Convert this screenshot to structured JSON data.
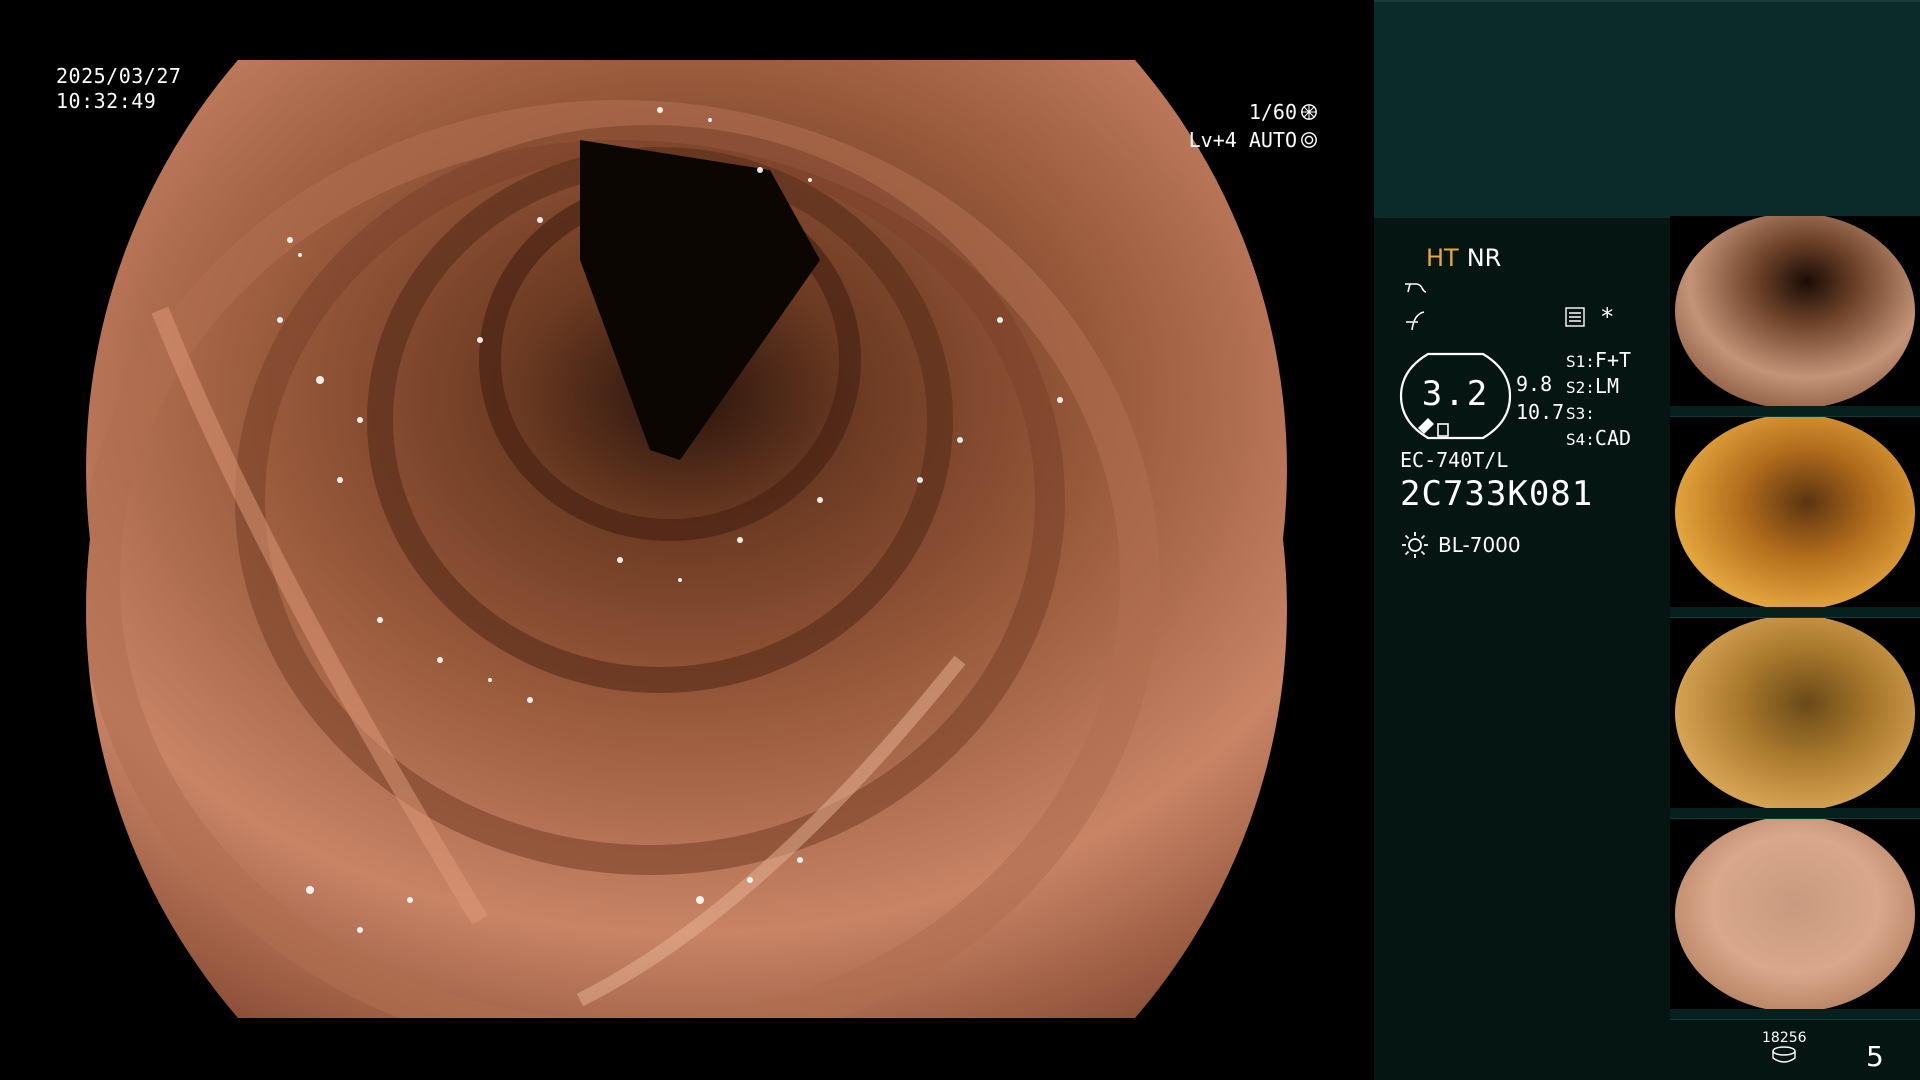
{
  "overlay": {
    "date": "2025/03/27",
    "time": "10:32:49",
    "shutter": "1/60",
    "iris": "Lv+4 AUTO"
  },
  "panel": {
    "mode_ht": "HT",
    "mode_nr": "NR",
    "gauge_value": "3.2",
    "gauge_upper": "9.8",
    "gauge_lower": "10.7",
    "presets": [
      {
        "key": "S1:",
        "value": "F+T"
      },
      {
        "key": "S2:",
        "value": "LM"
      },
      {
        "key": "S3:",
        "value": ""
      },
      {
        "key": "S4:",
        "value": "CAD"
      }
    ],
    "scope_model": "EC-740T/L",
    "scope_serial": "2C733K081",
    "light_source": "BL-7000",
    "storage_count": "18256",
    "capture_count": "5"
  },
  "icons": {
    "shutter": "shutter-icon",
    "iris": "iris-icon",
    "enhance": "enhance-icon",
    "flex": "flex-icon",
    "settings": "settings-icon",
    "light": "light-source-icon",
    "storage": "storage-icon"
  },
  "colors": {
    "panel_top": "#0b2b29",
    "panel_bg": "#041512",
    "mode_ht": "#e8a830"
  }
}
